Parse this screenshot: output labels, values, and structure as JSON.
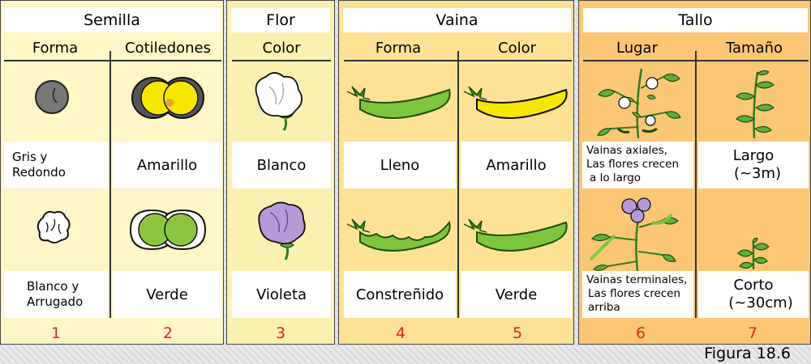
{
  "groups": {
    "semilla": "Semilla",
    "flor": "Flor",
    "vaina": "Vaina",
    "tallo": "Tallo"
  },
  "sub": {
    "forma1": "Forma",
    "cotiledones": "Cotiledones",
    "color_flor": "Color",
    "forma_vaina": "Forma",
    "color_vaina": "Color",
    "lugar": "Lugar",
    "tamano": "Tamaño"
  },
  "row1": {
    "c1_a": "Gris y",
    "c1_b": "Redondo",
    "c2": "Amarillo",
    "c3": "Blanco",
    "c4": "Lleno",
    "c5": "Amarillo",
    "c6_a": "Vainas axiales,",
    "c6_b": "Las flores crecen",
    "c6_c": "a lo largo",
    "c7_a": "Largo",
    "c7_b": "(~3m)"
  },
  "row2": {
    "c1_a": "Blanco y",
    "c1_b": "Arrugado",
    "c2": "Verde",
    "c3": "Violeta",
    "c4": "Constreñido",
    "c5": "Verde",
    "c6_a": "Vainas terminales,",
    "c6_b": "Las flores crecen",
    "c6_c": "arriba",
    "c7_a": "Corto",
    "c7_b": "(~30cm)"
  },
  "numbers": [
    "1",
    "2",
    "3",
    "4",
    "5",
    "6",
    "7"
  ],
  "caption": "Figura 18.6",
  "icons": [
    "gray-round-seed-icon",
    "white-wrinkled-seed-icon",
    "yellow-cotyledons-icon",
    "green-cotyledons-icon",
    "white-flower-icon",
    "violet-flower-icon",
    "full-green-pod-icon",
    "constricted-green-pod-icon",
    "yellow-pod-icon",
    "green-pod-icon",
    "axial-plant-icon",
    "terminal-plant-icon",
    "tall-plant-icon",
    "short-plant-icon"
  ]
}
